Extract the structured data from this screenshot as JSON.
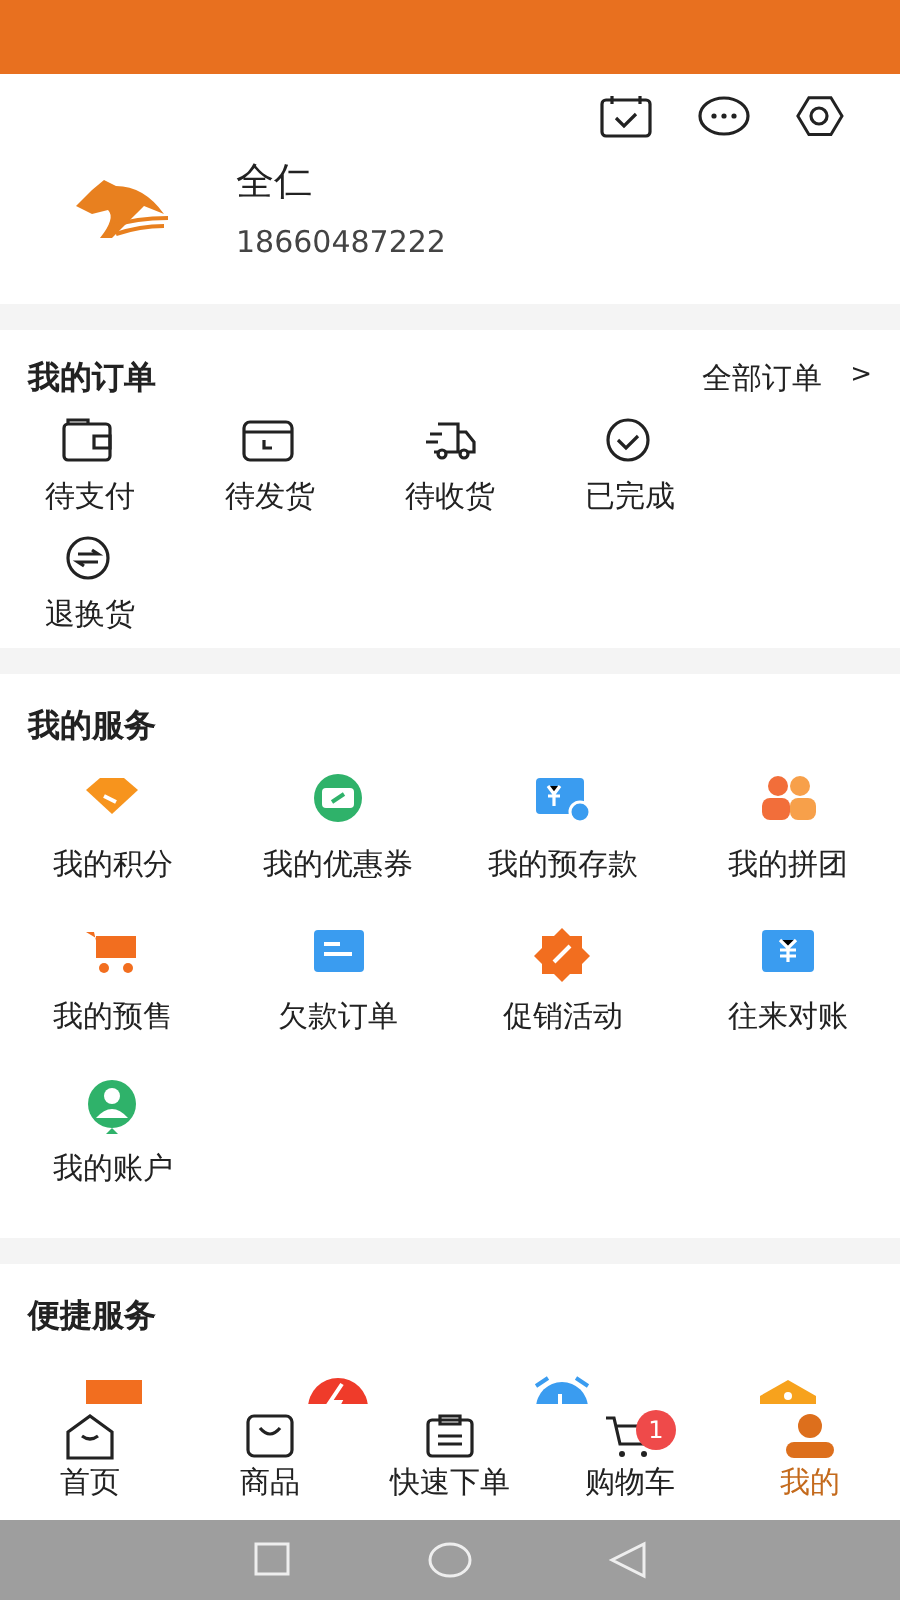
{
  "profile": {
    "name": "全仁",
    "phone": "18660487222"
  },
  "orders": {
    "title": "我的订单",
    "all_link": "全部订单",
    "chevron": ">",
    "items": [
      "待支付",
      "待发货",
      "待收货",
      "已完成",
      "退换货"
    ]
  },
  "services": {
    "title": "我的服务",
    "items": [
      "我的积分",
      "我的优惠券",
      "我的预存款",
      "我的拼团",
      "我的预售",
      "欠款订单",
      "促销活动",
      "往来对账",
      "我的账户"
    ]
  },
  "quick_services": {
    "title": "便捷服务"
  },
  "tab_bar": [
    {
      "label": "首页",
      "selected": false
    },
    {
      "label": "商品",
      "selected": false
    },
    {
      "label": "快速下单",
      "selected": false
    },
    {
      "label": "购物车",
      "selected": false,
      "badge": "1"
    },
    {
      "label": "我的",
      "selected": true
    }
  ]
}
